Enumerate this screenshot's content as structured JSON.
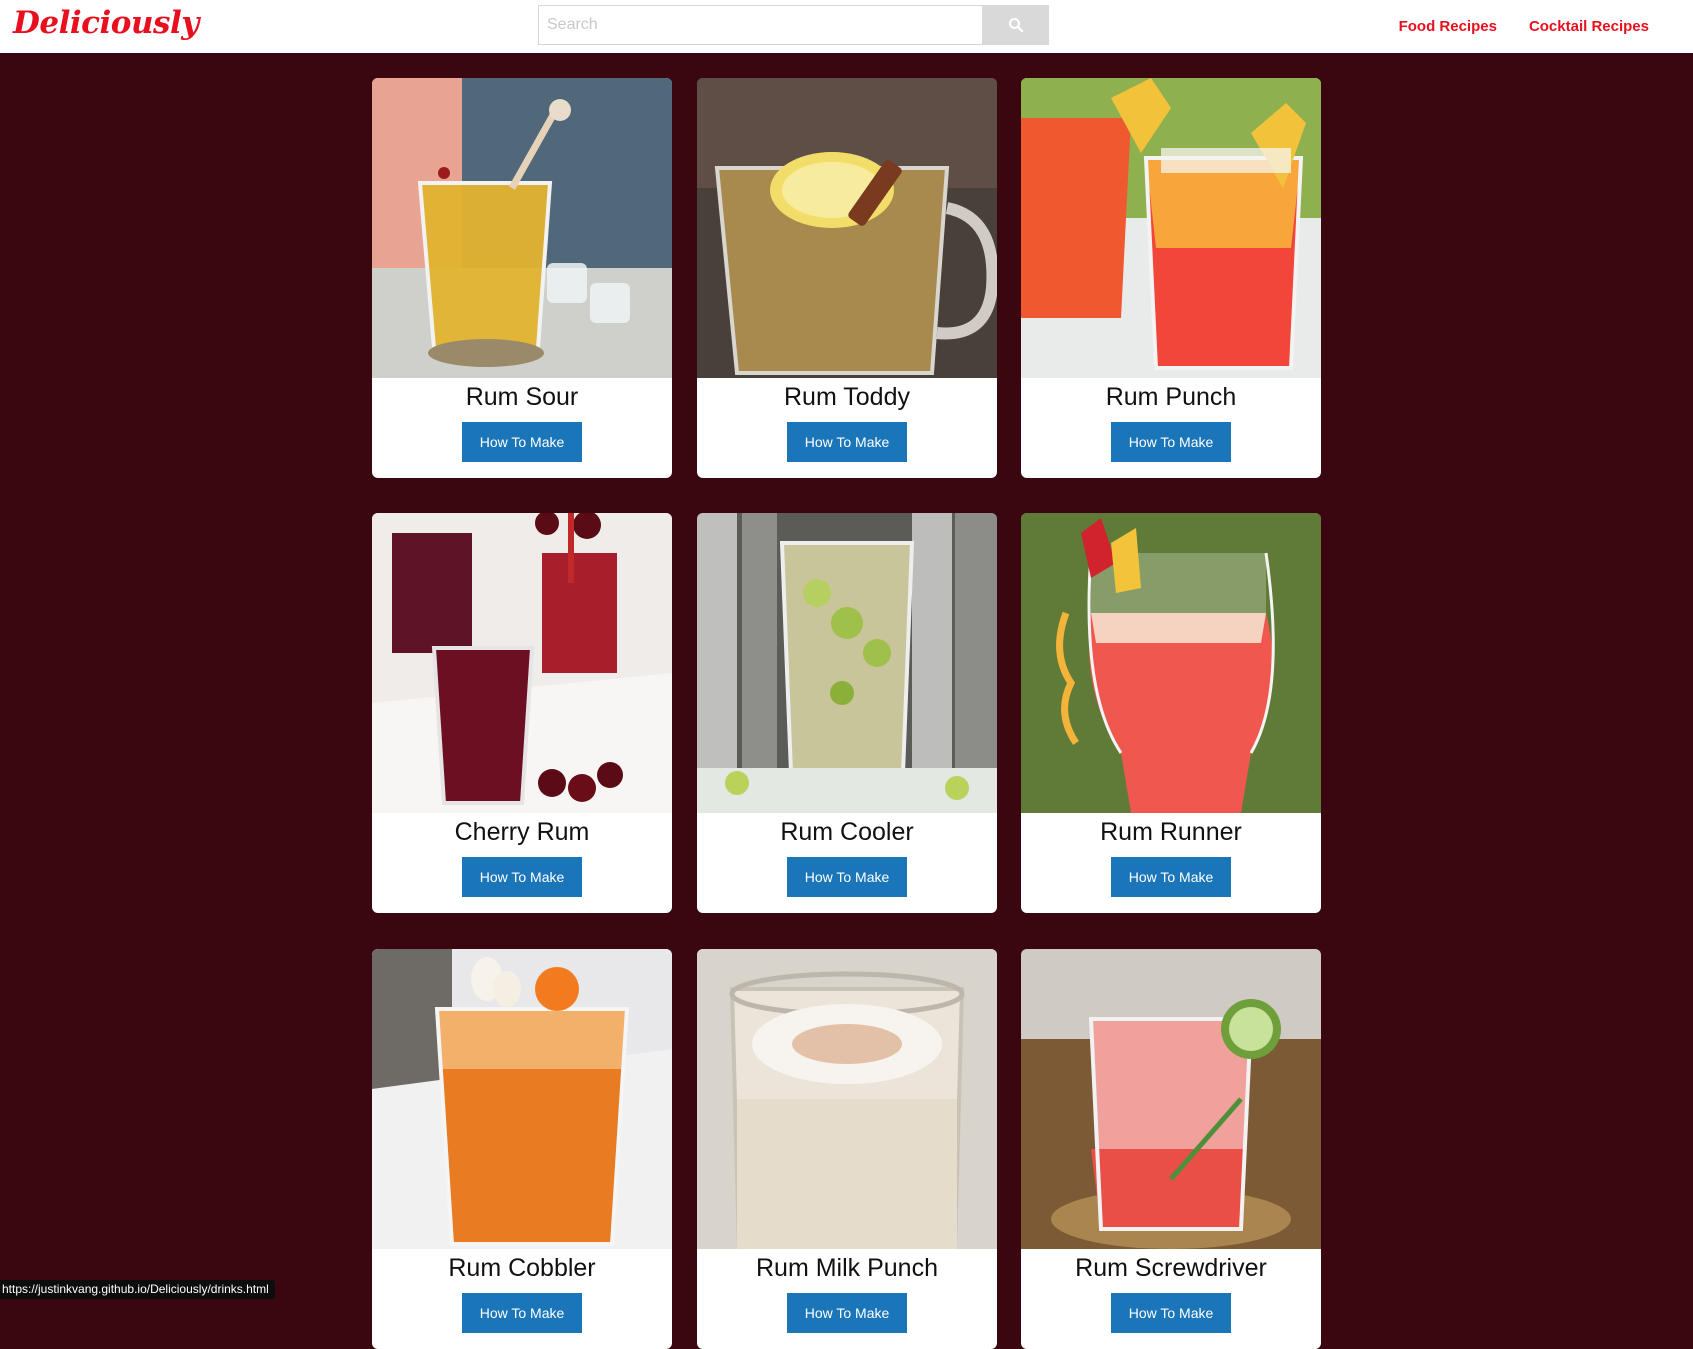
{
  "brand": "Deliciously",
  "search": {
    "placeholder": "Search"
  },
  "nav": {
    "food": "Food Recipes",
    "cocktail": "Cocktail Recipes"
  },
  "cards": [
    {
      "title": "Rum Sour",
      "button": "How To Make"
    },
    {
      "title": "Rum Toddy",
      "button": "How To Make"
    },
    {
      "title": "Rum Punch",
      "button": "How To Make"
    },
    {
      "title": "Cherry Rum",
      "button": "How To Make"
    },
    {
      "title": "Rum Cooler",
      "button": "How To Make"
    },
    {
      "title": "Rum Runner",
      "button": "How To Make"
    },
    {
      "title": "Rum Cobbler",
      "button": "How To Make"
    },
    {
      "title": "Rum Milk Punch",
      "button": "How To Make"
    },
    {
      "title": "Rum Screwdriver",
      "button": "How To Make"
    }
  ],
  "status_url": "https://justinkvang.github.io/Deliciously/drinks.html",
  "colors": {
    "brand": "#e8101e",
    "background": "#3a0610",
    "button": "#1b75b9"
  }
}
